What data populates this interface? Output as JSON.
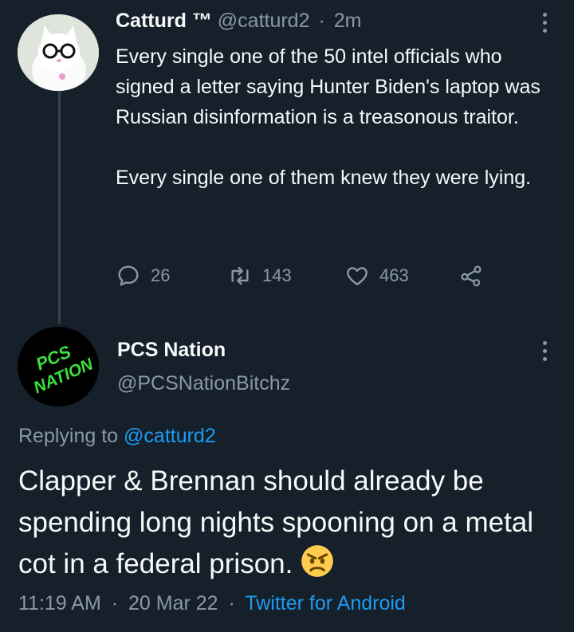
{
  "tweet1": {
    "display_name": "Catturd ™",
    "handle": "@catturd2",
    "separator": "·",
    "time": "2m",
    "text": "Every single one of the 50 intel officials who signed a letter saying Hunter Biden's laptop was Russian disinformation is a treasonous traitor.\n\nEvery single one of them knew they were lying.",
    "actions": {
      "replies": "26",
      "retweets": "143",
      "likes": "463"
    }
  },
  "tweet2": {
    "display_name": "PCS Nation",
    "handle": "@PCSNationBitchz",
    "avatar_text": [
      "PCS",
      "NATION"
    ],
    "replying_prefix": "Replying to",
    "replying_to": "@catturd2",
    "text": "Clapper & Brennan should already be spending long nights spooning on a metal cot in a federal prison.",
    "emoji": "angry-face",
    "time": "11:19 AM",
    "date": "20 Mar 22",
    "source": "Twitter for Android",
    "separator": "·"
  },
  "colors": {
    "background": "#15202b",
    "text": "#f7f9f9",
    "muted": "#8b98a5",
    "link": "#1d9bf0",
    "thread_line": "#38444d",
    "pcs_green": "#3be03b"
  },
  "icons": [
    "reply-icon",
    "retweet-icon",
    "like-icon",
    "share-icon",
    "more-icon"
  ]
}
